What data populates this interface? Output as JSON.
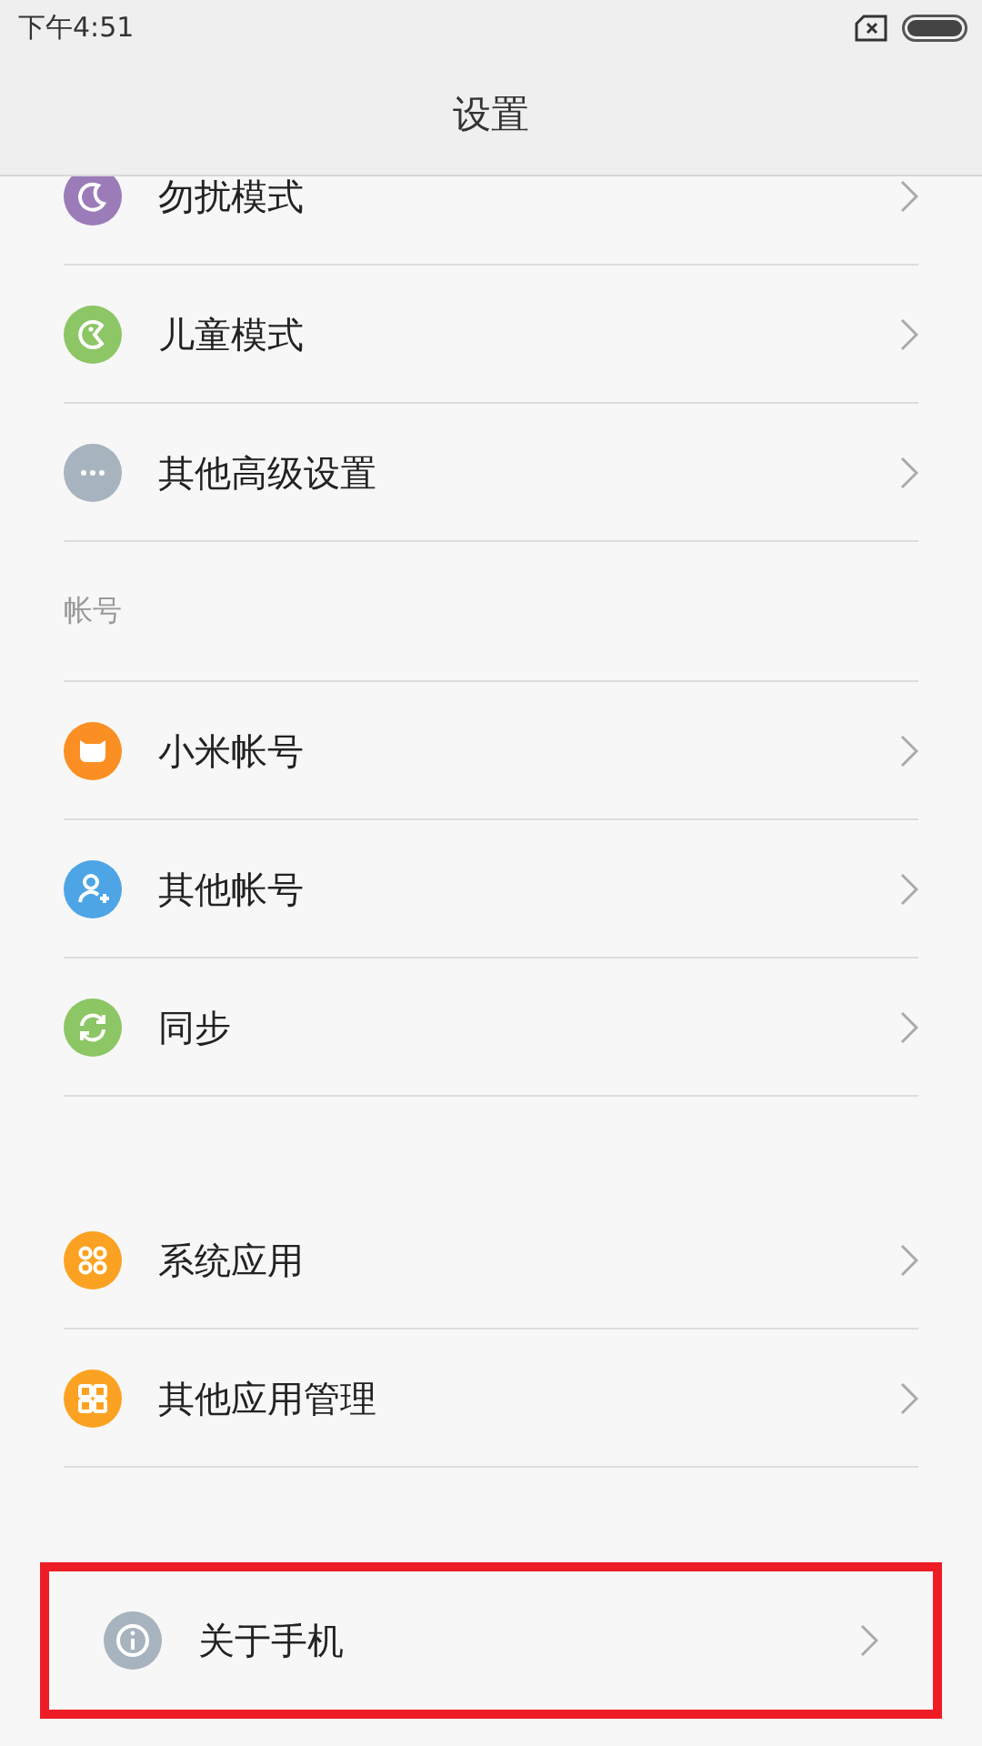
{
  "status_bar": {
    "time": "下午4:51"
  },
  "title": "设置",
  "sections": [
    {
      "items": [
        {
          "label": "勿扰模式",
          "color": "#9b7bb8",
          "highlighted": false
        },
        {
          "label": "儿童模式",
          "color": "#8cc665",
          "highlighted": false
        },
        {
          "label": "其他高级设置",
          "color": "#a7b3be",
          "highlighted": false
        }
      ]
    },
    {
      "header": "帐号",
      "items": [
        {
          "label": "小米帐号",
          "color": "#fb8f24",
          "highlighted": false
        },
        {
          "label": "其他帐号",
          "color": "#4ea5e6",
          "highlighted": false
        },
        {
          "label": "同步",
          "color": "#8cc665",
          "highlighted": false
        }
      ]
    },
    {
      "items": [
        {
          "label": "系统应用",
          "color": "#fca222",
          "highlighted": false
        },
        {
          "label": "其他应用管理",
          "color": "#fca222",
          "highlighted": false
        }
      ]
    },
    {
      "items": [
        {
          "label": "关于手机",
          "color": "#a7b3be",
          "highlighted": true
        }
      ]
    }
  ]
}
